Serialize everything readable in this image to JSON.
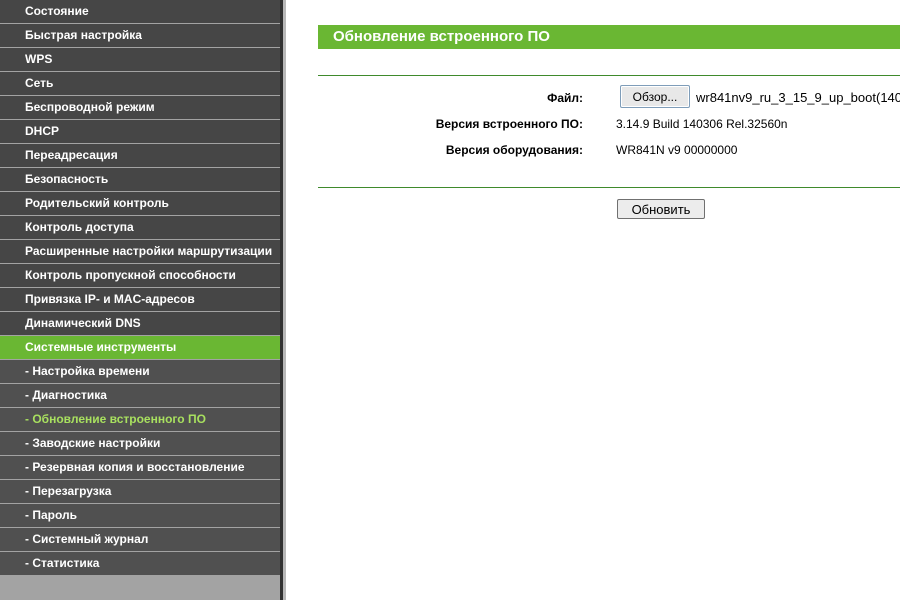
{
  "sidebar": {
    "items": [
      {
        "label": "Состояние"
      },
      {
        "label": "Быстрая настройка"
      },
      {
        "label": "WPS"
      },
      {
        "label": "Сеть"
      },
      {
        "label": "Беспроводной режим"
      },
      {
        "label": "DHCP"
      },
      {
        "label": "Переадресация"
      },
      {
        "label": "Безопасность"
      },
      {
        "label": "Родительский контроль"
      },
      {
        "label": "Контроль доступа"
      },
      {
        "label": "Расширенные настройки маршрутизации"
      },
      {
        "label": "Контроль пропускной способности"
      },
      {
        "label": "Привязка IP- и MAC-адресов"
      },
      {
        "label": "Динамический DNS"
      },
      {
        "label": "Системные инструменты"
      }
    ],
    "subitems": [
      {
        "label": "- Настройка времени"
      },
      {
        "label": "- Диагностика"
      },
      {
        "label": "- Обновление встроенного ПО"
      },
      {
        "label": "- Заводские настройки"
      },
      {
        "label": "- Резервная копия и восстановление"
      },
      {
        "label": "- Перезагрузка"
      },
      {
        "label": "- Пароль"
      },
      {
        "label": "- Системный журнал"
      },
      {
        "label": "- Статистика"
      }
    ]
  },
  "main": {
    "title": "Обновление встроенного ПО",
    "file_label": "Файл:",
    "browse_label": "Обзор...",
    "file_name": "wr841nv9_ru_3_15_9_up_boot(140",
    "firmware_label": "Версия встроенного ПО:",
    "firmware_value": "3.14.9 Build 140306 Rel.32560n",
    "hardware_label": "Версия оборудования:",
    "hardware_value": "WR841N v9 00000000",
    "update_label": "Обновить"
  },
  "colors": {
    "accent_green": "#6ab733",
    "sidebar_dark": "#464646",
    "active_sub_text": "#a8e05f"
  }
}
